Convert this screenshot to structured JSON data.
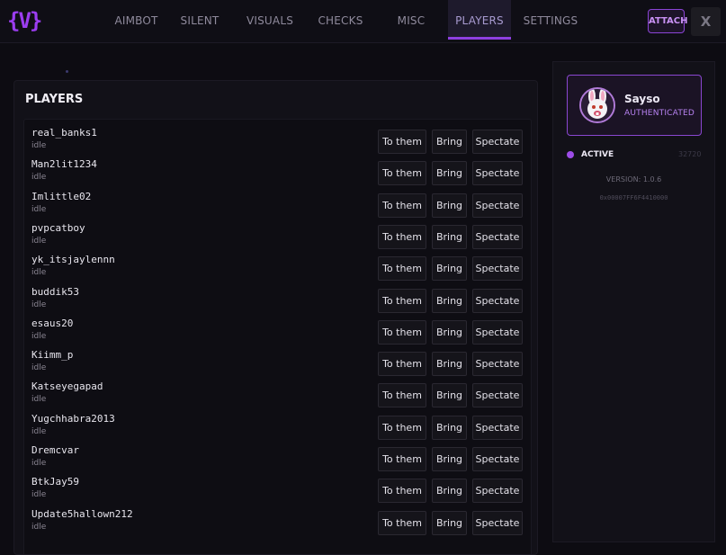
{
  "app": {
    "logo_text": "{V}",
    "accent_color": "#9b3df0"
  },
  "nav": {
    "tabs": [
      {
        "label": "AIMBOT"
      },
      {
        "label": "SILENT"
      },
      {
        "label": "VISUALS"
      },
      {
        "label": "CHECKS"
      },
      {
        "label": "MISC"
      },
      {
        "label": "PLAYERS",
        "active": true
      },
      {
        "label": "SETTINGS"
      }
    ],
    "attach_label": "ATTACH",
    "close_label": "X"
  },
  "players": {
    "title": "PLAYERS",
    "button_labels": {
      "to_them": "To them",
      "bring": "Bring",
      "spectate": "Spectate"
    },
    "list": [
      {
        "name": "real_banks1",
        "status": "idle"
      },
      {
        "name": "Man2lit1234",
        "status": "idle"
      },
      {
        "name": "Imlittle02",
        "status": "idle"
      },
      {
        "name": "pvpcatboy",
        "status": "idle"
      },
      {
        "name": "yk_itsjaylennn",
        "status": "idle"
      },
      {
        "name": "buddik53",
        "status": "idle"
      },
      {
        "name": "esaus20",
        "status": "idle"
      },
      {
        "name": "Kiimm_p",
        "status": "idle"
      },
      {
        "name": "Katseyegapad",
        "status": "idle"
      },
      {
        "name": "Yugchhabra2013",
        "status": "idle"
      },
      {
        "name": "Dremcvar",
        "status": "idle"
      },
      {
        "name": "BtkJay59",
        "status": "idle"
      },
      {
        "name": "Update5hallown212",
        "status": "idle"
      }
    ]
  },
  "profile": {
    "username": "Sayso",
    "auth_status": "AUTHENTICATED",
    "avatar_icon": "bunny-avatar",
    "active_label": "ACTIVE",
    "active_count": "32720",
    "version": "VERSION: 1.0.6",
    "address": "0x00007FF6F4410000"
  }
}
